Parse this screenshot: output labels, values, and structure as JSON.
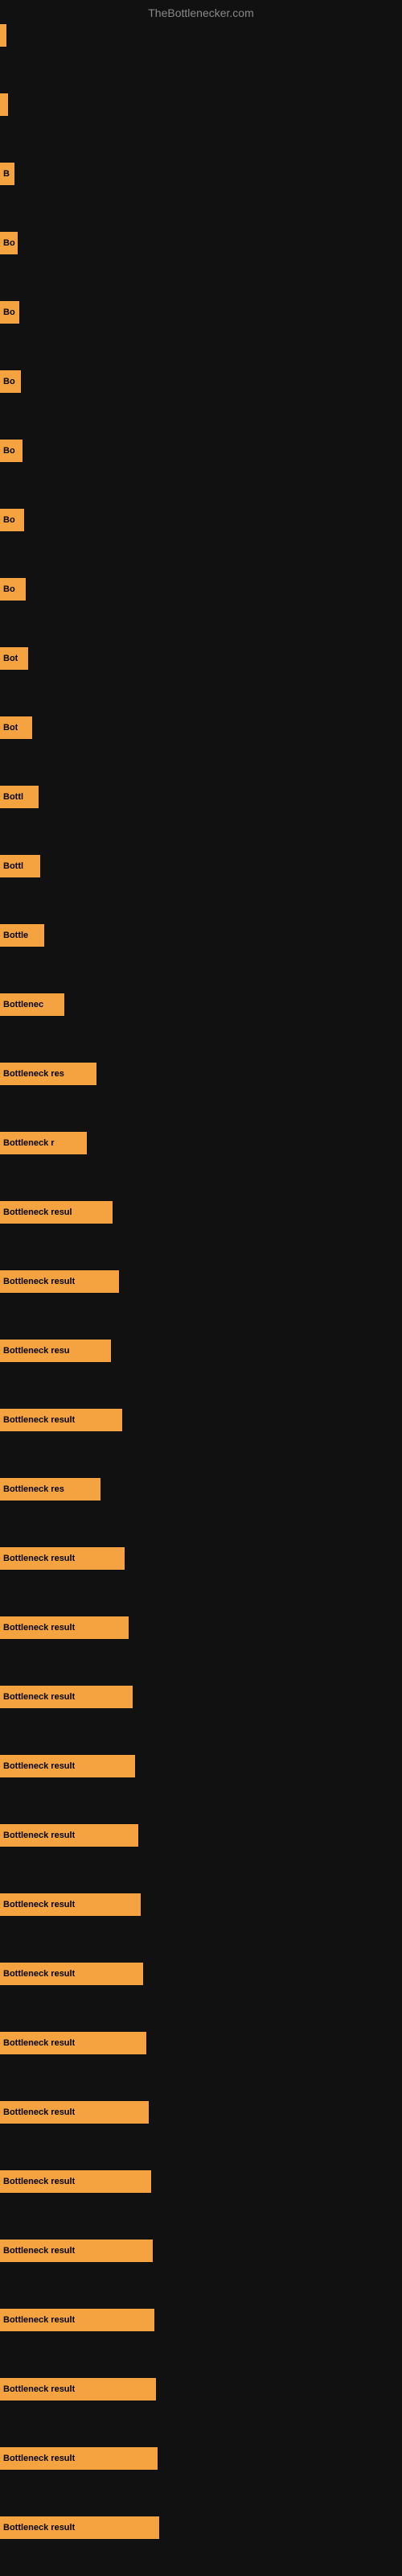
{
  "site_title": "TheBottlenecker.com",
  "bars": [
    {
      "label": "",
      "width": 8,
      "gap": 58
    },
    {
      "label": "",
      "width": 10,
      "gap": 58
    },
    {
      "label": "B",
      "width": 18,
      "gap": 58
    },
    {
      "label": "Bo",
      "width": 22,
      "gap": 58
    },
    {
      "label": "Bo",
      "width": 24,
      "gap": 58
    },
    {
      "label": "Bo",
      "width": 26,
      "gap": 58
    },
    {
      "label": "Bo",
      "width": 28,
      "gap": 58
    },
    {
      "label": "Bo",
      "width": 30,
      "gap": 58
    },
    {
      "label": "Bo",
      "width": 32,
      "gap": 58
    },
    {
      "label": "Bot",
      "width": 35,
      "gap": 58
    },
    {
      "label": "Bot",
      "width": 40,
      "gap": 58
    },
    {
      "label": "Bottl",
      "width": 48,
      "gap": 58
    },
    {
      "label": "Bottl",
      "width": 50,
      "gap": 58
    },
    {
      "label": "Bottle",
      "width": 55,
      "gap": 58
    },
    {
      "label": "Bottlenec",
      "width": 80,
      "gap": 58
    },
    {
      "label": "Bottleneck res",
      "width": 120,
      "gap": 58
    },
    {
      "label": "Bottleneck r",
      "width": 108,
      "gap": 58
    },
    {
      "label": "Bottleneck resul",
      "width": 140,
      "gap": 58
    },
    {
      "label": "Bottleneck result",
      "width": 148,
      "gap": 58
    },
    {
      "label": "Bottleneck resu",
      "width": 138,
      "gap": 58
    },
    {
      "label": "Bottleneck result",
      "width": 152,
      "gap": 58
    },
    {
      "label": "Bottleneck res",
      "width": 125,
      "gap": 58
    },
    {
      "label": "Bottleneck result",
      "width": 155,
      "gap": 58
    },
    {
      "label": "Bottleneck result",
      "width": 160,
      "gap": 58
    },
    {
      "label": "Bottleneck result",
      "width": 165,
      "gap": 58
    },
    {
      "label": "Bottleneck result",
      "width": 168,
      "gap": 58
    },
    {
      "label": "Bottleneck result",
      "width": 172,
      "gap": 58
    },
    {
      "label": "Bottleneck result",
      "width": 175,
      "gap": 58
    },
    {
      "label": "Bottleneck result",
      "width": 178,
      "gap": 58
    },
    {
      "label": "Bottleneck result",
      "width": 182,
      "gap": 58
    },
    {
      "label": "Bottleneck result",
      "width": 185,
      "gap": 58
    },
    {
      "label": "Bottleneck result",
      "width": 188,
      "gap": 58
    },
    {
      "label": "Bottleneck result",
      "width": 190,
      "gap": 58
    },
    {
      "label": "Bottleneck result",
      "width": 192,
      "gap": 58
    },
    {
      "label": "Bottleneck result",
      "width": 194,
      "gap": 58
    },
    {
      "label": "Bottleneck result",
      "width": 196,
      "gap": 58
    },
    {
      "label": "Bottleneck result",
      "width": 198,
      "gap": 0
    }
  ]
}
